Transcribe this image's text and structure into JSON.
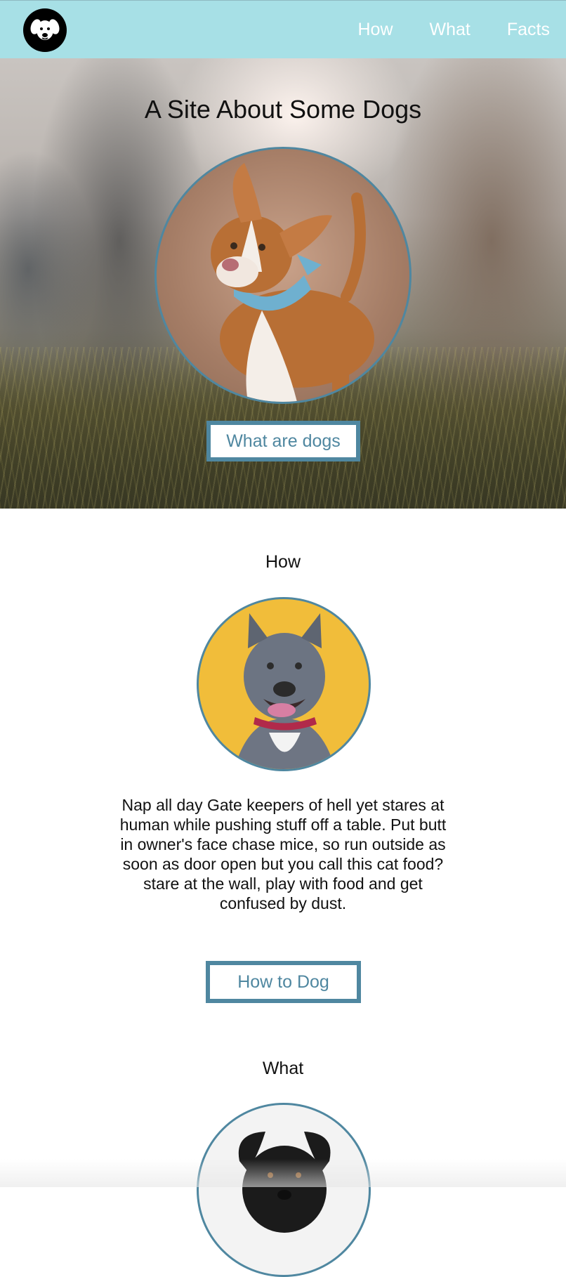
{
  "navbar": {
    "logo_icon": "dog-face-icon",
    "links": [
      {
        "label": "How"
      },
      {
        "label": "What"
      },
      {
        "label": "Facts"
      }
    ],
    "background": "#a7e0e6"
  },
  "hero": {
    "title": "A Site About Some Dogs",
    "photo": "dog-portrait-brown-white-bandana",
    "button_label": "What are dogs"
  },
  "how": {
    "heading": "How",
    "photo": "dog-portrait-gray-yellow-background",
    "text": "Nap all day Gate keepers of hell yet stares at human while pushing stuff off a table. Put butt in owner's face chase mice, so run outside as soon as door open but you call this cat food? stare at the wall, play with food and get confused by dust.",
    "button_label": "How to Dog"
  },
  "what": {
    "heading": "What",
    "photo": "dog-portrait-black-white-background"
  },
  "colors": {
    "accent": "#4f87a0",
    "nav_text": "#ffffff"
  }
}
